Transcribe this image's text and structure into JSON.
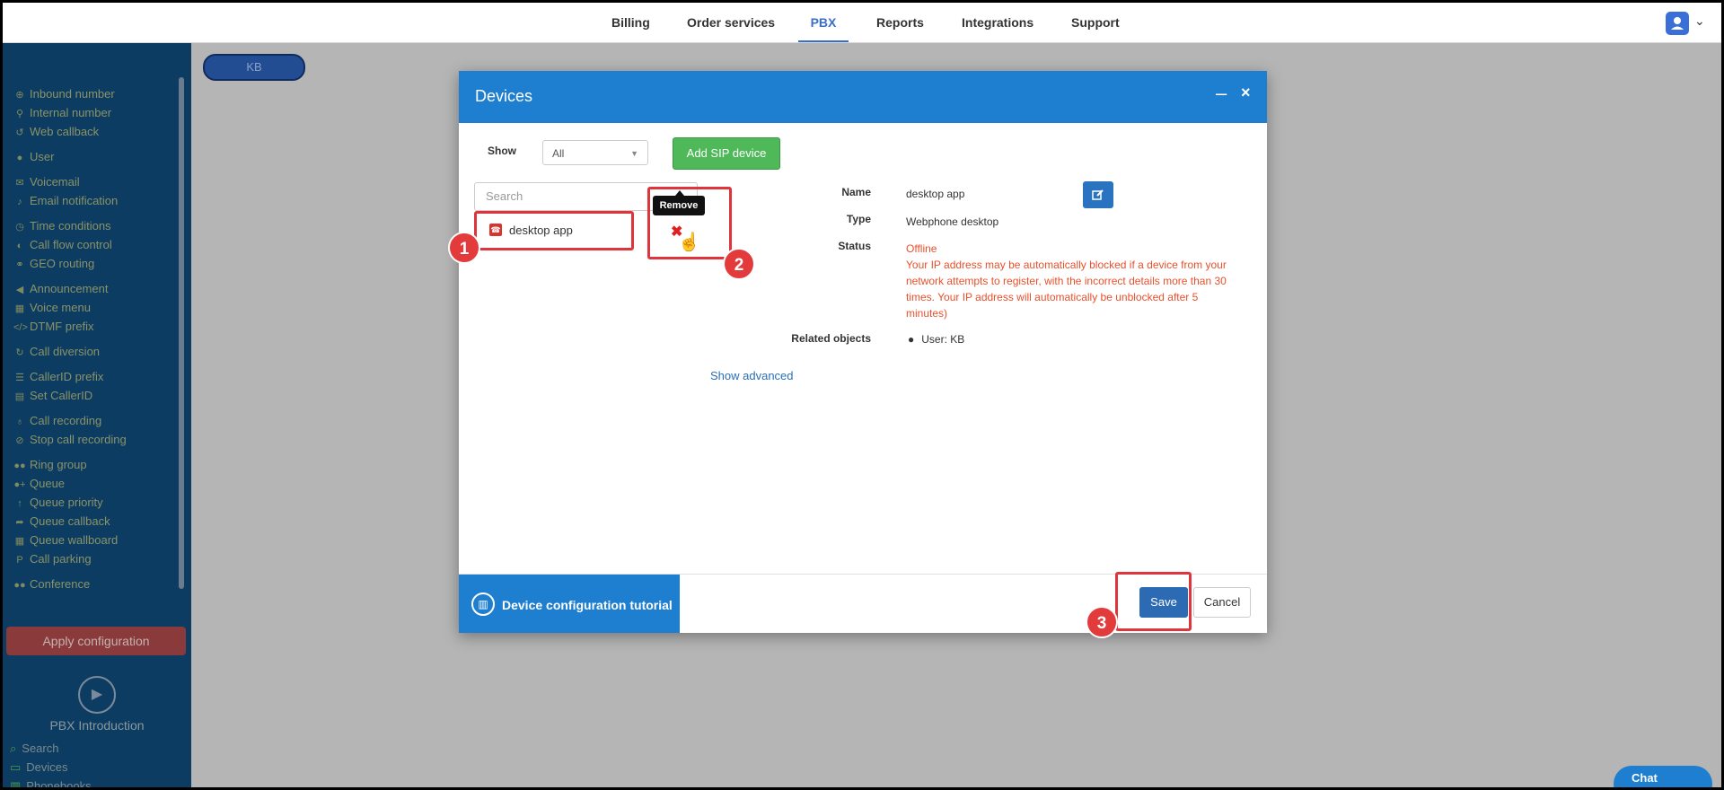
{
  "topnav": {
    "items": [
      {
        "label": "Billing",
        "active": false
      },
      {
        "label": "Order services",
        "active": false
      },
      {
        "label": "PBX",
        "active": true
      },
      {
        "label": "Reports",
        "active": false
      },
      {
        "label": "Integrations",
        "active": false
      },
      {
        "label": "Support",
        "active": false
      }
    ],
    "user_icon": "user-icon",
    "caret": "⌄"
  },
  "sidebar": {
    "items": [
      {
        "label": "Inbound number",
        "icon": "plus-circle-icon",
        "glyph": "⊕"
      },
      {
        "label": "Internal number",
        "icon": "map-pin-icon",
        "glyph": "⚲"
      },
      {
        "label": "Web callback",
        "icon": "undo-icon",
        "glyph": "↺"
      },
      {
        "label": "User",
        "icon": "user-icon",
        "glyph": "●"
      },
      {
        "label": "Voicemail",
        "icon": "envelope-icon",
        "glyph": "✉"
      },
      {
        "label": "Email notification",
        "icon": "bell-icon",
        "glyph": "♪"
      },
      {
        "label": "Time conditions",
        "icon": "clock-icon",
        "glyph": "◷"
      },
      {
        "label": "Call flow control",
        "icon": "toggle-icon",
        "glyph": "◐"
      },
      {
        "label": "GEO routing",
        "icon": "sitemap-icon",
        "glyph": "⚭"
      },
      {
        "label": "Announcement",
        "icon": "megaphone-icon",
        "glyph": "◀"
      },
      {
        "label": "Voice menu",
        "icon": "table-icon",
        "glyph": "▦"
      },
      {
        "label": "DTMF prefix",
        "icon": "code-icon",
        "glyph": "</>"
      },
      {
        "label": "Call diversion",
        "icon": "redo-icon",
        "glyph": "↻"
      },
      {
        "label": "CallerID prefix",
        "icon": "list-icon",
        "glyph": "☰"
      },
      {
        "label": "Set CallerID",
        "icon": "id-card-icon",
        "glyph": "▤"
      },
      {
        "label": "Call recording",
        "icon": "microphone-icon",
        "glyph": "♁"
      },
      {
        "label": "Stop call recording",
        "icon": "mic-slash-icon",
        "glyph": "⊘"
      },
      {
        "label": "Ring group",
        "icon": "users-icon",
        "glyph": "●●"
      },
      {
        "label": "Queue",
        "icon": "user-plus-icon",
        "glyph": "●+"
      },
      {
        "label": "Queue priority",
        "icon": "arrow-up-icon",
        "glyph": "↑"
      },
      {
        "label": "Queue callback",
        "icon": "share-icon",
        "glyph": "➦"
      },
      {
        "label": "Queue wallboard",
        "icon": "grid-icon",
        "glyph": "▦"
      },
      {
        "label": "Call parking",
        "icon": "parking-icon",
        "glyph": "P"
      },
      {
        "label": "Conference",
        "icon": "comments-icon",
        "glyph": "●●"
      }
    ],
    "apply_label": "Apply configuration",
    "intro_label": "PBX Introduction",
    "bottom_items": [
      {
        "label": "Search",
        "icon": "search-icon",
        "glyph": "⌕"
      },
      {
        "label": "Devices",
        "icon": "monitor-icon",
        "glyph": "▭"
      },
      {
        "label": "Phonebooks",
        "icon": "book-icon",
        "glyph": "▥"
      }
    ]
  },
  "canvas": {
    "kb_label": "KB"
  },
  "modal": {
    "title": "Devices",
    "minimize": "–",
    "close": "×",
    "show_label": "Show",
    "filter_value": "All",
    "add_sip_label": "Add SIP device",
    "search_placeholder": "Search",
    "device_name": "desktop app",
    "tooltip": "Remove",
    "fields": {
      "name_label": "Name",
      "name_value": "desktop app",
      "type_label": "Type",
      "type_value": "Webphone desktop",
      "status_label": "Status",
      "status_value": "Offline",
      "status_note": "Your IP address may be automatically blocked if a device from your network attempts to register, with the incorrect details more than 30 times. Your IP address will automatically be unblocked after 5 minutes)",
      "related_label": "Related objects",
      "related_value": "User: KB"
    },
    "show_advanced": "Show advanced",
    "tutorial_label": "Device configuration tutorial",
    "save_label": "Save",
    "cancel_label": "Cancel"
  },
  "annotations": [
    "1",
    "2",
    "3"
  ],
  "chat_label": "Chat",
  "colors": {
    "header_blue": "#1e7ecf",
    "sidebar_bg": "#0d3c63",
    "add_green": "#4fb95a",
    "status_red": "#e8502c",
    "highlight_red": "#e0343c"
  }
}
